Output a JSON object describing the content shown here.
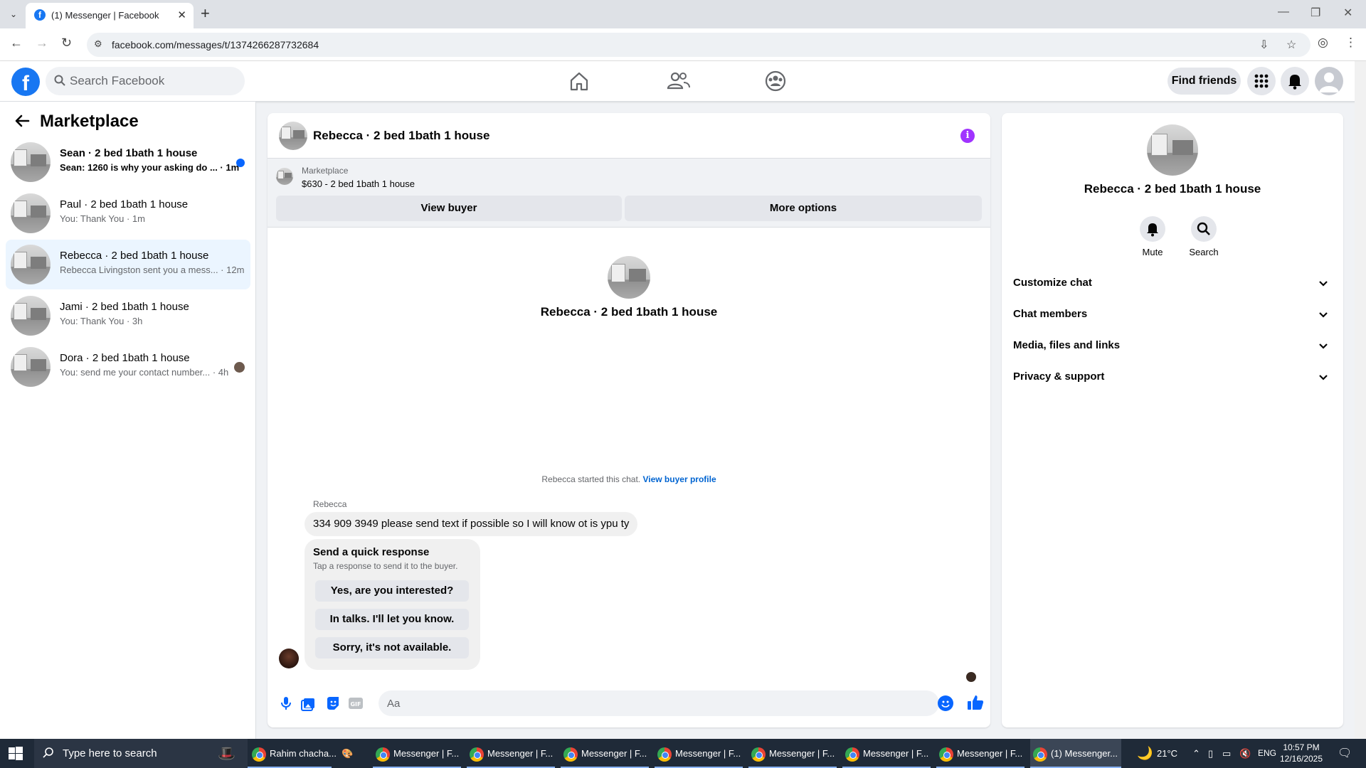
{
  "browser": {
    "tab_title": "(1) Messenger | Facebook",
    "url": "facebook.com/messages/t/1374266287732684"
  },
  "fb_header": {
    "search_placeholder": "Search Facebook",
    "find_friends": "Find friends"
  },
  "sidebar": {
    "title": "Marketplace",
    "conversations": [
      {
        "name": "Sean · 2 bed 1bath 1 house",
        "preview": "Sean: 1260 is why your asking do ... · 1m",
        "unread": true
      },
      {
        "name": "Paul · 2 bed 1bath 1 house",
        "preview": "You: Thank You · 1m"
      },
      {
        "name": "Rebecca · 2 bed 1bath 1 house",
        "preview": "Rebecca Livingston sent you a mess... · 12m",
        "active": true
      },
      {
        "name": "Jami · 2 bed 1bath 1 house",
        "preview": "You: Thank You · 3h"
      },
      {
        "name": "Dora · 2 bed 1bath 1 house",
        "preview": "You: send me your contact number... · 4h"
      }
    ]
  },
  "chat": {
    "header_title": "Rebecca · 2 bed 1bath 1 house",
    "marketplace_label": "Marketplace",
    "listing": "$630 - 2 bed 1bath 1 house",
    "view_buyer": "View buyer",
    "more_options": "More options",
    "intro_name": "Rebecca · 2 bed 1bath 1 house",
    "started_text": "Rebecca started this chat.",
    "view_buyer_profile": "View buyer profile",
    "sender": "Rebecca",
    "message": "334 909 3949 please send text if possible so I will know ot is ypu ty",
    "quick_title": "Send a quick response",
    "quick_sub": "Tap a response to send it to the buyer.",
    "quick_responses": [
      "Yes, are you interested?",
      "In talks. I'll let you know.",
      "Sorry, it's not available."
    ],
    "composer_placeholder": "Aa"
  },
  "info": {
    "name": "Rebecca · 2 bed 1bath 1 house",
    "mute": "Mute",
    "search": "Search",
    "sections": [
      "Customize chat",
      "Chat members",
      "Media, files and links",
      "Privacy & support"
    ]
  },
  "taskbar": {
    "search_placeholder": "Type here to search",
    "apps": [
      "Rahim chacha...",
      "Messenger | F...",
      "Messenger | F...",
      "Messenger | F...",
      "Messenger | F...",
      "Messenger | F...",
      "Messenger | F...",
      "Messenger | F...",
      "(1) Messenger..."
    ],
    "temperature": "21°C",
    "language": "ENG",
    "time": "10:57 PM",
    "date": "12/16/2025"
  },
  "colors": {
    "fb_blue": "#1877f2",
    "messenger_blue": "#0866ff",
    "active_row": "#ebf5ff",
    "info_purple": "#a033ff"
  }
}
